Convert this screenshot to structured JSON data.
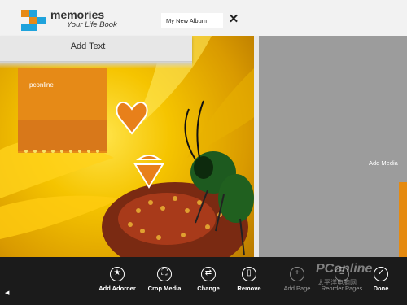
{
  "app": {
    "name": "memories",
    "subtitle": "Your Life Book"
  },
  "album": {
    "title": "My New Album"
  },
  "banner": {
    "label": "Add Text"
  },
  "note": {
    "text": "pconline"
  },
  "right_page": {
    "label": "Add Media"
  },
  "watermark": {
    "text": "PConline",
    "sub": "太平洋电脑网"
  },
  "colors": {
    "orange": "#e68a17",
    "blue": "#1fa3dc",
    "toolbar": "#1b1b1b"
  },
  "toolbar": {
    "buttons": [
      {
        "label": "Add Adorner",
        "icon": "star-icon"
      },
      {
        "label": "Crop Media",
        "icon": "crop-icon"
      },
      {
        "label": "Change",
        "icon": "change-media-icon"
      },
      {
        "label": "Remove",
        "icon": "trash-icon"
      },
      {
        "label": "Add Page",
        "icon": "plus-icon"
      },
      {
        "label": "Reorder Pages",
        "icon": "reorder-icon"
      },
      {
        "label": "Done",
        "icon": "check-icon"
      }
    ]
  }
}
